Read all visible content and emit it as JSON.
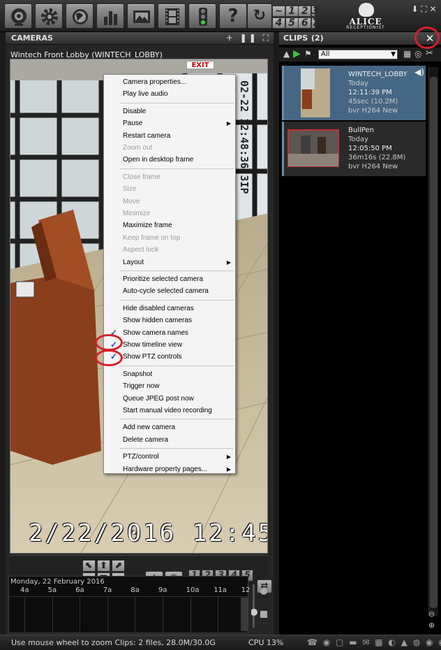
{
  "toolbar": {
    "icons": [
      "camera-icon",
      "gear-icon",
      "globe-icon",
      "stats-icon",
      "image-icon",
      "film-icon",
      "traffic-light-icon",
      "help-icon"
    ],
    "help_glyph": "?",
    "refresh_glyph": "↻",
    "layout_cells": [
      "~",
      "1",
      "2",
      "3",
      "4",
      "5",
      "6",
      "7"
    ]
  },
  "brand": {
    "line1": "ALICE",
    "line2": "RECEPTIONIST"
  },
  "window_controls": [
    "⬇",
    "⛶",
    "✕"
  ],
  "cameras": {
    "title": "CAMERAS",
    "header_icons": "+ ❚❚ ⛶",
    "camera_name": "Wintech Front Lobby (WINTECH_LOBBY)",
    "overlay_timestamp": "2/22/2016 12:45:",
    "overlay_side": "02-22 12:48:36 3IP",
    "exit_sign": "EXIT"
  },
  "context_menu": [
    {
      "label": "Camera properties...",
      "enabled": true
    },
    {
      "label": "Play live audio",
      "enabled": true
    },
    {
      "sep": true
    },
    {
      "label": "Disable",
      "enabled": true
    },
    {
      "label": "Pause",
      "enabled": true,
      "submenu": true
    },
    {
      "label": "Restart camera",
      "enabled": true
    },
    {
      "label": "Zoom out",
      "enabled": false
    },
    {
      "label": "Open in desktop frame",
      "enabled": true
    },
    {
      "sep": true
    },
    {
      "label": "Close frame",
      "enabled": false
    },
    {
      "label": "Size",
      "enabled": false
    },
    {
      "label": "Move",
      "enabled": false
    },
    {
      "label": "Minimize",
      "enabled": false
    },
    {
      "label": "Maximize frame",
      "enabled": true
    },
    {
      "label": "Keep frame on top",
      "enabled": false
    },
    {
      "label": "Aspect lock",
      "enabled": false
    },
    {
      "label": "Layout",
      "enabled": true,
      "submenu": true
    },
    {
      "sep": true
    },
    {
      "label": "Prioritize selected camera",
      "enabled": true
    },
    {
      "label": "Auto-cycle selected camera",
      "enabled": true
    },
    {
      "sep": true
    },
    {
      "label": "Hide disabled cameras",
      "enabled": true
    },
    {
      "label": "Show hidden cameras",
      "enabled": true
    },
    {
      "label": "Show camera names",
      "enabled": true,
      "checked": true
    },
    {
      "label": "Show timeline view",
      "enabled": true,
      "checked": true
    },
    {
      "label": "Show PTZ controls",
      "enabled": true,
      "checked": true
    },
    {
      "sep": true
    },
    {
      "label": "Snapshot",
      "enabled": true
    },
    {
      "label": "Trigger now",
      "enabled": true
    },
    {
      "label": "Queue JPEG post now",
      "enabled": true
    },
    {
      "label": "Start manual video recording",
      "enabled": true
    },
    {
      "sep": true
    },
    {
      "label": "Add new camera",
      "enabled": true
    },
    {
      "label": "Delete camera",
      "enabled": true
    },
    {
      "sep": true
    },
    {
      "label": "PTZ/control",
      "enabled": true,
      "submenu": true
    },
    {
      "label": "Hardware property pages...",
      "enabled": true,
      "submenu": true
    }
  ],
  "ptz": {
    "dpad": [
      "⬉",
      "⬆",
      "⬈",
      "⬅",
      "■",
      "➡",
      "⬋",
      "⬇",
      "⬊"
    ],
    "zoom_in": "+",
    "zoom_out": "−",
    "eye_glyph": "◉",
    "presets": [
      "1",
      "2",
      "3",
      "4",
      "5"
    ],
    "preset_selected": "",
    "cycle_glyph": "⇄"
  },
  "timeline": {
    "date": "Monday, 22 February 2016",
    "ticks": [
      "4a",
      "5a",
      "6a",
      "7a",
      "8a",
      "9a",
      "10a",
      "11a",
      "12"
    ]
  },
  "clips": {
    "title": "CLIPS",
    "count": "(2)",
    "close_glyph": "✕",
    "filter_value": "All",
    "items": [
      {
        "name": "WINTECH_LOBBY",
        "day": "Today",
        "time": "12:11:39 PM",
        "duration": "45sec (10.2M)",
        "codec": "bvr H264 New",
        "selected": true
      },
      {
        "name": "BullPen",
        "day": "Today",
        "time": "12:05:50 PM",
        "duration": "36m16s (22.8M)",
        "codec": "bvr H264 New",
        "selected": false
      }
    ]
  },
  "status": {
    "text": "Use mouse wheel to zoom  Clips: 2 files, 28.0M/30.0G",
    "cpu": "CPU 13%",
    "icons": "☎ ◉ ▢ ▬ ✉ ▦ ◐ ▲ ◍ ◉ ◉"
  },
  "colors": {
    "annotation_red": "#d4202a",
    "selected_clip": "#466783",
    "check_blue": "#2b4fb0"
  }
}
